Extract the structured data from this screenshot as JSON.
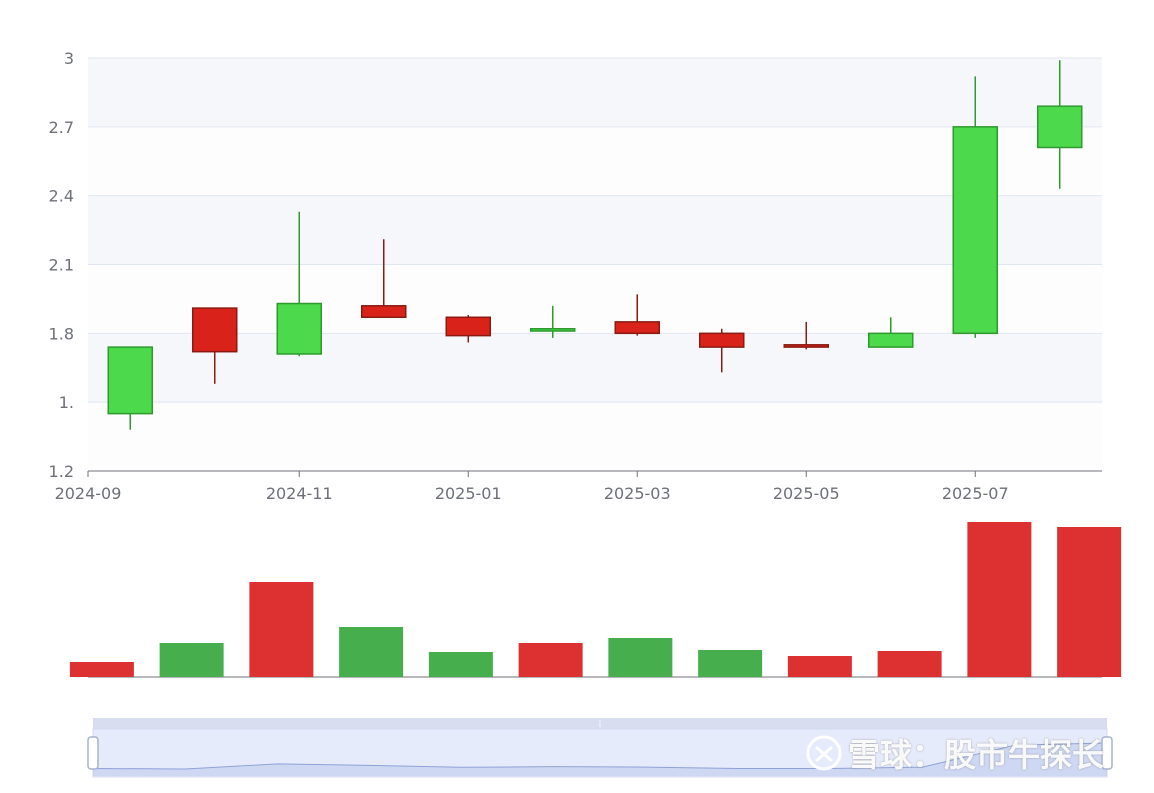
{
  "chart_data": [
    {
      "type": "candlestick",
      "x": [
        "2024-09",
        "2024-10",
        "2024-11",
        "2024-12",
        "2025-01",
        "2025-02",
        "2025-03",
        "2025-04",
        "2025-05",
        "2025-06",
        "2025-07",
        "2025-08"
      ],
      "ohlc": [
        {
          "open": 1.45,
          "close": 1.74,
          "low": 1.38,
          "high": 1.74
        },
        {
          "open": 1.91,
          "close": 1.72,
          "low": 1.58,
          "high": 1.91
        },
        {
          "open": 1.71,
          "close": 1.93,
          "low": 1.7,
          "high": 2.33
        },
        {
          "open": 1.92,
          "close": 1.87,
          "low": 1.87,
          "high": 2.21
        },
        {
          "open": 1.87,
          "close": 1.79,
          "low": 1.76,
          "high": 1.88
        },
        {
          "open": 1.81,
          "close": 1.82,
          "low": 1.78,
          "high": 1.92
        },
        {
          "open": 1.85,
          "close": 1.8,
          "low": 1.79,
          "high": 1.97
        },
        {
          "open": 1.8,
          "close": 1.74,
          "low": 1.63,
          "high": 1.82
        },
        {
          "open": 1.75,
          "close": 1.74,
          "low": 1.73,
          "high": 1.85
        },
        {
          "open": 1.74,
          "close": 1.8,
          "low": 1.74,
          "high": 1.87
        },
        {
          "open": 1.8,
          "close": 2.7,
          "low": 1.78,
          "high": 2.92
        },
        {
          "open": 2.61,
          "close": 2.79,
          "low": 2.43,
          "high": 2.99
        }
      ],
      "y_ticks": [
        "1.2",
        "1.",
        "1.8",
        "2.1",
        "2.4",
        "2.7",
        "3"
      ],
      "ylim": [
        1.2,
        3.0
      ],
      "x_tick_labels": [
        "2024-09",
        "2024-11",
        "2025-01",
        "2025-03",
        "2025-05",
        "2025-07"
      ],
      "colors": {
        "up": "#4cd94c",
        "down": "#d9231a",
        "up_border": "#2e9a2e",
        "down_border": "#8b1a12"
      },
      "grid": true
    },
    {
      "type": "bar",
      "x": [
        "2024-09",
        "2024-10",
        "2024-11",
        "2024-12",
        "2025-01",
        "2025-02",
        "2025-03",
        "2025-04",
        "2025-05",
        "2025-06",
        "2025-07",
        "2025-08"
      ],
      "values": [
        15,
        34,
        95,
        50,
        25,
        34,
        39,
        27,
        21,
        26,
        155,
        150
      ],
      "colors": [
        "#dd3131",
        "#47ae4d",
        "#dd3131",
        "#47ae4d",
        "#47ae4d",
        "#dd3131",
        "#47ae4d",
        "#47ae4d",
        "#dd3131",
        "#dd3131",
        "#dd3131",
        "#dd3131"
      ]
    }
  ],
  "slider": {
    "handle_glyph": "⁞",
    "preview_values": [
      1.74,
      1.72,
      1.93,
      1.87,
      1.79,
      1.82,
      1.8,
      1.74,
      1.74,
      1.8,
      2.7,
      2.79
    ]
  },
  "watermark": {
    "text": "雪球：股市牛探长",
    "logo": "xueqiu-logo-icon"
  }
}
